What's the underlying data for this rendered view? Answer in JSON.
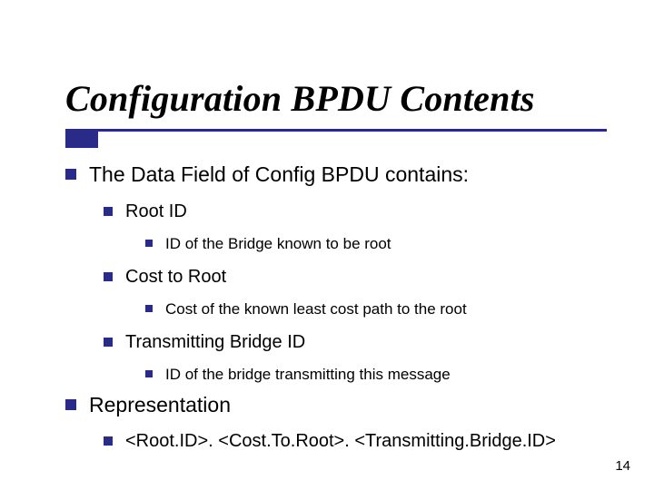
{
  "title": "Configuration BPDU Contents",
  "lines": {
    "l1a": "The Data Field of Config BPDU contains:",
    "l2a": "Root ID",
    "l3a": "ID of the Bridge known to be root",
    "l2b": "Cost to Root",
    "l3b": "Cost of the known least cost path to the root",
    "l2c": "Transmitting Bridge ID",
    "l3c": "ID of the bridge transmitting this message",
    "l1b": "Representation",
    "l2d": "<Root.ID>. <Cost.To.Root>. <Transmitting.Bridge.ID>"
  },
  "page_number": "14"
}
